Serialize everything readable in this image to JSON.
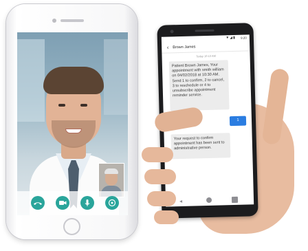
{
  "left_phone": {
    "icons": {
      "hangup": "phone-icon",
      "video": "video-camera-icon",
      "mic": "microphone-icon",
      "switch": "camera-switch-icon"
    },
    "accent": "#2aa59b"
  },
  "right_phone": {
    "status": {
      "time": "9:20"
    },
    "contact_name": "Brown James",
    "date_label": "Today 10:13 AM",
    "messages": [
      {
        "direction": "incoming",
        "text": "Patient Brown James, Your appointment with smith william on 04/02/2018 at 10:30 AM. Send 1 to confirm, 2 to cancel, 3 to reschedule or 4 to unsubscribe appointment reminder service."
      },
      {
        "direction": "outgoing",
        "text": "1"
      },
      {
        "direction": "incoming",
        "text": "Your request to confirm appointment has been sent to administrative person."
      }
    ],
    "colors": {
      "outgoing_bubble": "#2b7de1",
      "incoming_bubble": "#ececec"
    }
  }
}
